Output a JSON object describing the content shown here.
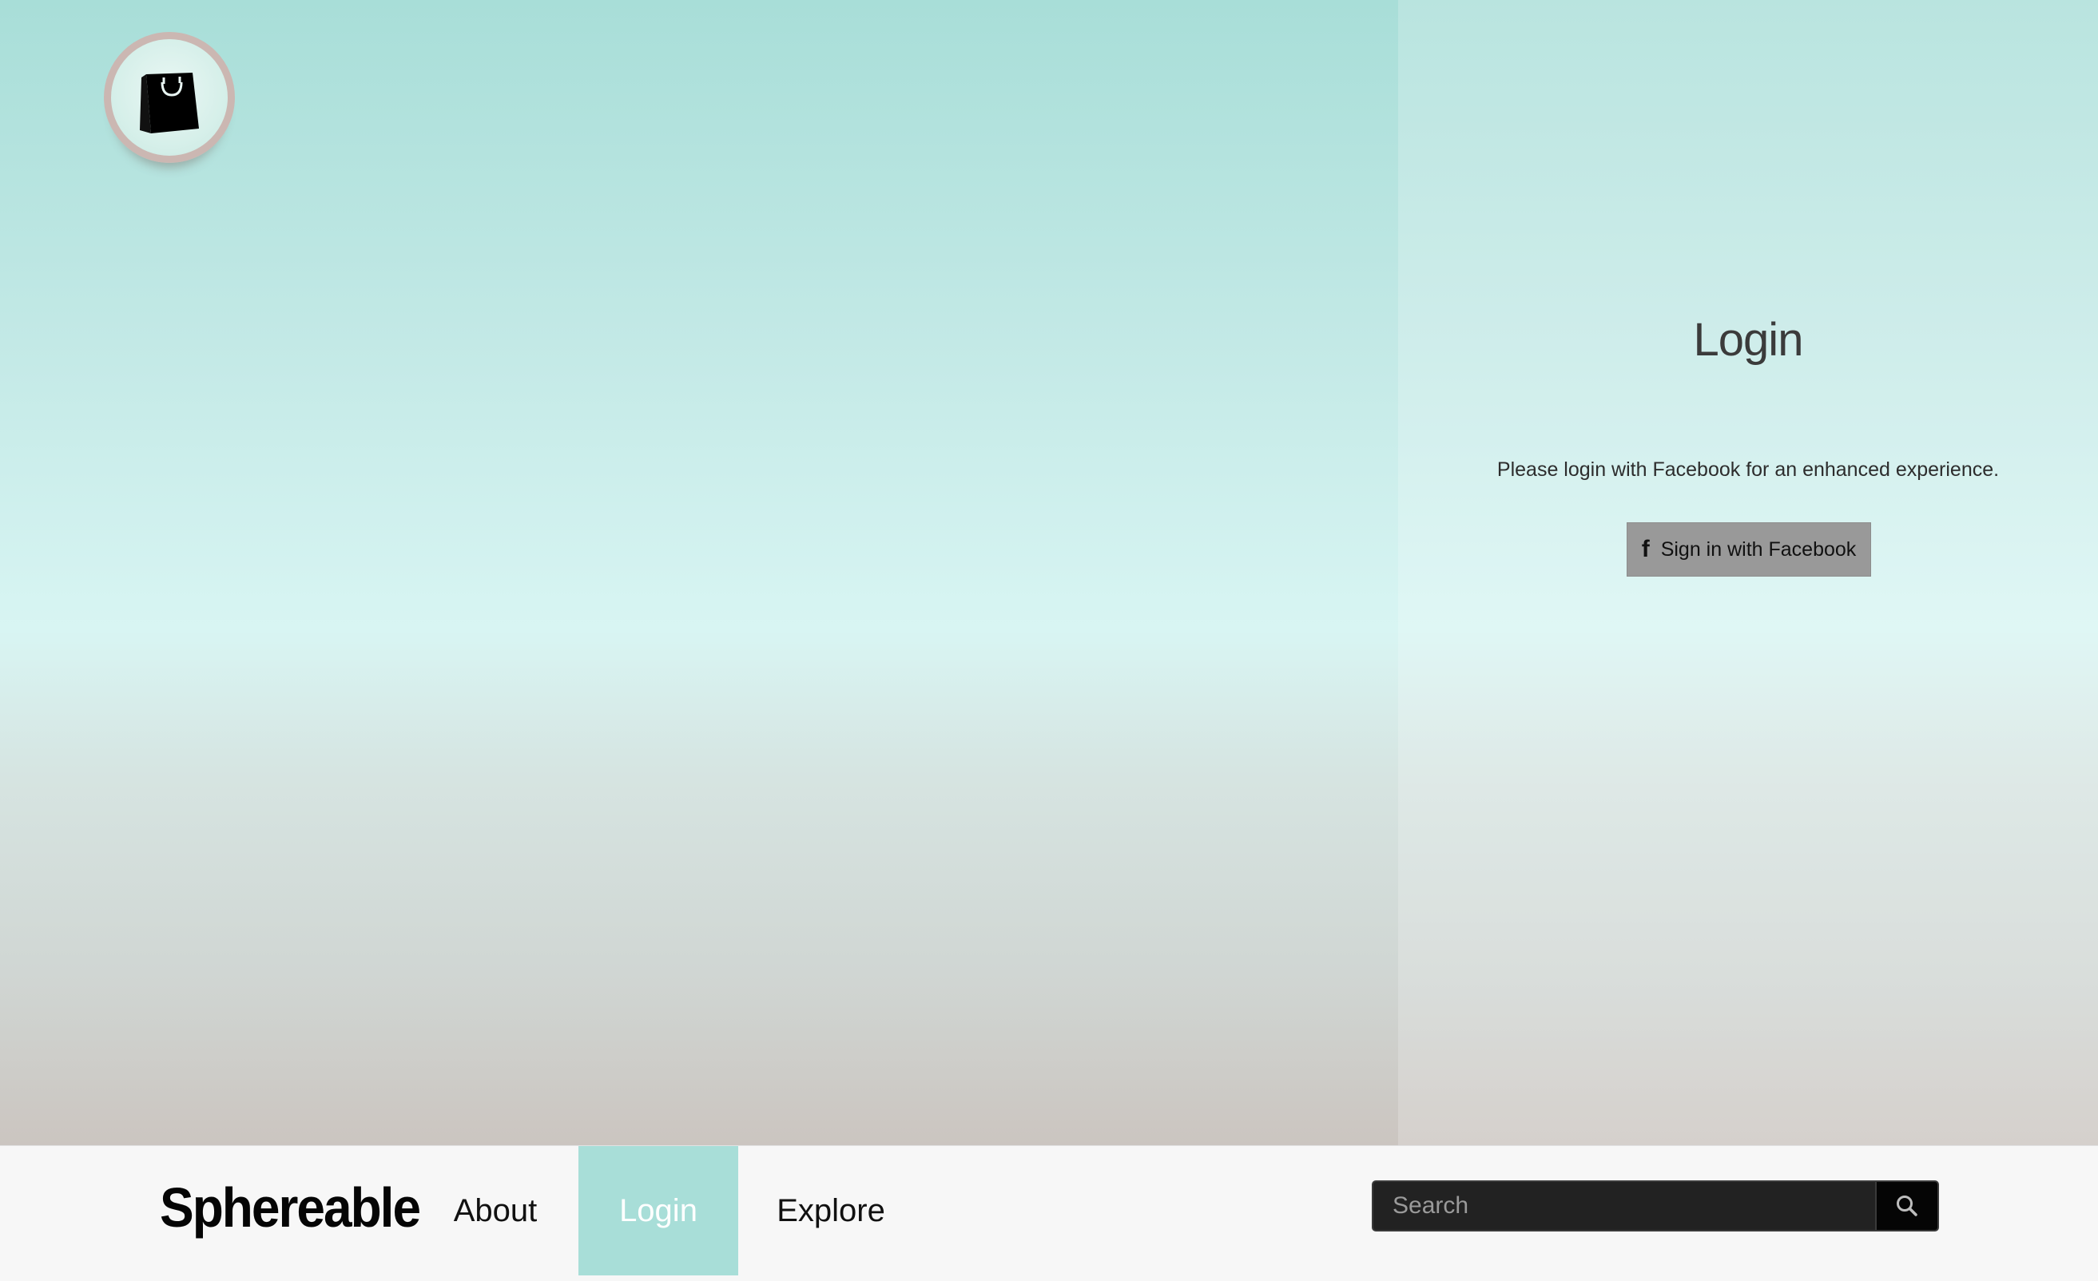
{
  "logo": {
    "icon": "shopping-bag-icon"
  },
  "login_panel": {
    "title": "Login",
    "description": "Please login with Facebook for an enhanced experience.",
    "facebook_button": {
      "icon": "facebook-icon",
      "icon_glyph": "f",
      "label": "Sign in with Facebook"
    }
  },
  "navbar": {
    "brand": "Sphereable",
    "items": [
      {
        "label": "About",
        "active": false
      },
      {
        "label": "Login",
        "active": true
      },
      {
        "label": "Explore",
        "active": false
      }
    ],
    "search": {
      "placeholder": "Search",
      "value": "",
      "button_icon": "search-icon"
    }
  },
  "colors": {
    "accent": "#a8ded8",
    "facebook_button_bg": "#999999",
    "search_bg": "#222222",
    "navbar_bg": "#f7f7f7"
  }
}
